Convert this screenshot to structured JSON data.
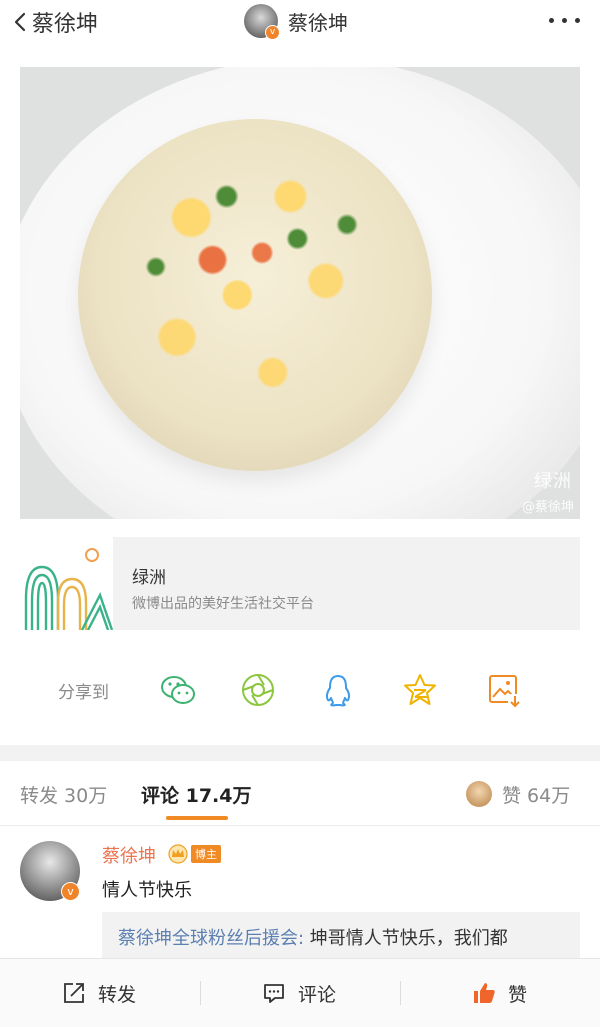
{
  "header": {
    "back_label": "蔡徐坤",
    "title": "蔡徐坤"
  },
  "post": {
    "image_watermark_brand": "绿洲",
    "image_watermark_user": "@蔡徐坤"
  },
  "link_card": {
    "title": "绿洲",
    "description": "微博出品的美好生活社交平台"
  },
  "share": {
    "label": "分享到",
    "icons": [
      "wechat-icon",
      "moments-icon",
      "qq-icon",
      "qzone-icon",
      "save-image-icon"
    ]
  },
  "tabs": {
    "repost": "转发 30万",
    "comments": "评论 17.4万",
    "likes": "赞 64万"
  },
  "comment": {
    "author": "蔡徐坤",
    "badge": "博主",
    "text": "情人节快乐",
    "reply_author": "蔡徐坤全球粉丝后援会:",
    "reply_text": " 坤哥情人节快乐，我们都"
  },
  "bottom_bar": {
    "repost": "转发",
    "comment": "评论",
    "like": "赞"
  },
  "colors": {
    "accent_orange": "#f08a24",
    "name_orange": "#eb7350",
    "link_blue": "#5b7fb1"
  }
}
